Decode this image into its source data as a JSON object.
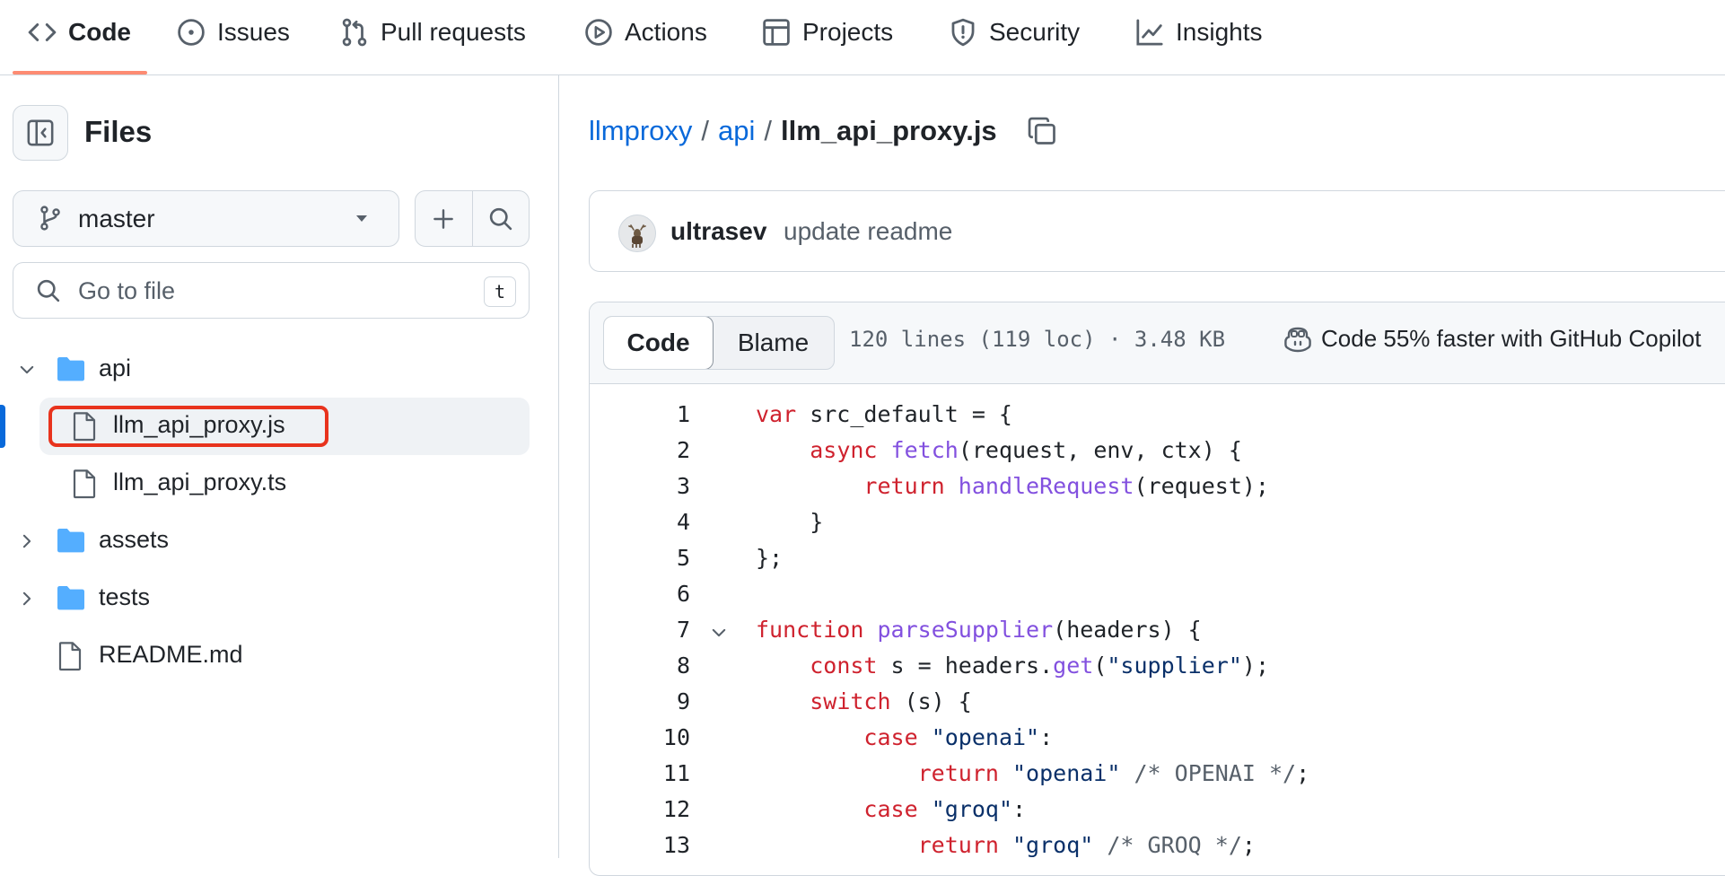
{
  "nav": {
    "tabs": [
      {
        "label": "Code",
        "icon": "code-icon",
        "active": true
      },
      {
        "label": "Issues",
        "icon": "issue-opened-icon"
      },
      {
        "label": "Pull requests",
        "icon": "git-pull-request-icon"
      },
      {
        "label": "Actions",
        "icon": "play-icon"
      },
      {
        "label": "Projects",
        "icon": "table-icon"
      },
      {
        "label": "Security",
        "icon": "shield-icon"
      },
      {
        "label": "Insights",
        "icon": "graph-icon"
      }
    ]
  },
  "sidebar": {
    "title": "Files",
    "branch": "master",
    "goto_placeholder": "Go to file",
    "goto_shortcut": "t",
    "tree": [
      {
        "label": "api",
        "type": "folder",
        "expanded": true
      },
      {
        "label": "llm_api_proxy.js",
        "type": "file",
        "selected": true
      },
      {
        "label": "llm_api_proxy.ts",
        "type": "file"
      },
      {
        "label": "assets",
        "type": "folder",
        "expanded": false
      },
      {
        "label": "tests",
        "type": "folder",
        "expanded": false
      },
      {
        "label": "README.md",
        "type": "file"
      }
    ]
  },
  "breadcrumb": {
    "repo": "llmproxy",
    "sep1": "/",
    "dir": "api",
    "sep2": "/",
    "file": "llm_api_proxy.js"
  },
  "commit": {
    "author": "ultrasev",
    "message": "update readme"
  },
  "file_header": {
    "tab_code": "Code",
    "tab_blame": "Blame",
    "meta": "120 lines (119 loc) · 3.48 KB",
    "copilot": "Code 55% faster with GitHub Copilot"
  },
  "code_lines": [
    "var src_default = {",
    "    async fetch(request, env, ctx) {",
    "        return handleRequest(request);",
    "    }",
    "};",
    "",
    "function parseSupplier(headers) {",
    "    const s = headers.get(\"supplier\");",
    "    switch (s) {",
    "        case \"openai\":",
    "            return \"openai\" /* OPENAI */;",
    "        case \"groq\":",
    "            return \"groq\" /* GROQ */;"
  ],
  "line_numbers": [
    "1",
    "2",
    "3",
    "4",
    "5",
    "6",
    "7",
    "8",
    "9",
    "10",
    "11",
    "12",
    "13"
  ],
  "colors": {
    "accent_blue": "#0969da",
    "tab_underline": "#fd8c73",
    "highlight_red": "#e8331d",
    "folder_blue": "#54aeff",
    "keyword_red": "#cf222e",
    "function_purple": "#8250df",
    "string_navy": "#0a3069"
  }
}
